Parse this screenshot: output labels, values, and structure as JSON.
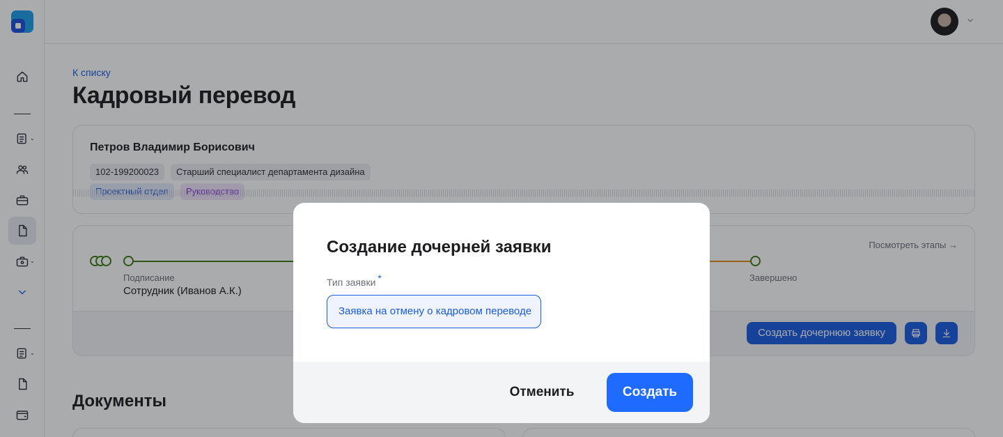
{
  "sidebar": {
    "items": [
      {
        "name": "home-icon"
      },
      {
        "name": "list-icon"
      },
      {
        "name": "users-icon"
      },
      {
        "name": "briefcase-icon"
      },
      {
        "name": "document-icon",
        "active": true
      },
      {
        "name": "bag-settings-icon"
      },
      {
        "name": "chevron-down-icon"
      },
      {
        "name": "list-icon"
      },
      {
        "name": "document-icon"
      },
      {
        "name": "wallet-icon"
      }
    ]
  },
  "header": {
    "avatar": "user-avatar"
  },
  "main": {
    "back_link": "К списку",
    "title": "Кадровый перевод",
    "person": {
      "name": "Петров Владимир Борисович",
      "id": "102-199200023",
      "position": "Старший специалист департамента дизайна",
      "department": "Проектный отдел",
      "role": "Руководство"
    },
    "stages": {
      "view_link": "Посмотреть этапы →",
      "current_label": "Подписание",
      "current_person": "Сотрудник (Иванов А.К.)",
      "last_label": "Завершено"
    },
    "actions": {
      "create_child": "Создать дочернюю заявку"
    },
    "documents_title": "Документы"
  },
  "modal": {
    "title": "Создание дочерней заявки",
    "field_label": "Тип заявки",
    "required_mark": "*",
    "field_value": "Заявка на отмену о кадровом переводе",
    "cancel": "Отменить",
    "create": "Создать"
  },
  "colors": {
    "accent": "#1a5ce0",
    "primary_button": "#1f6bff",
    "stage_green": "#3b7a12",
    "stage_orange": "#e58a1a"
  }
}
